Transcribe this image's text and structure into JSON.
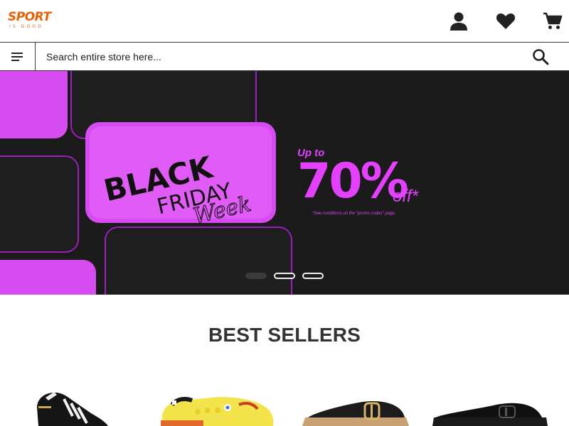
{
  "header": {
    "logo_text": "SPORT",
    "logo_tagline": "IS GOOD",
    "brand_color": "#e8620c",
    "icons": [
      "account-icon",
      "wishlist-heart-icon",
      "cart-icon"
    ]
  },
  "search": {
    "placeholder": "Search entire store here...",
    "menu_icon": "menu-icon",
    "search_icon": "search-icon"
  },
  "hero": {
    "line1": "BLACK",
    "line2": "FRIDAY",
    "line3": "Week",
    "up_to": "Up to",
    "percent": "70%",
    "off": "off*",
    "conditions": "*See conditions on the \"promo codes\" page.",
    "accent_color": "#e540ff",
    "slides": 3,
    "active_slide": 1
  },
  "best_sellers": {
    "title": "BEST SELLERS",
    "products": [
      {
        "name": "black-white-football-boot"
      },
      {
        "name": "yellow-clog"
      },
      {
        "name": "black-strap-sandal"
      },
      {
        "name": "black-slide-sandal"
      }
    ]
  }
}
